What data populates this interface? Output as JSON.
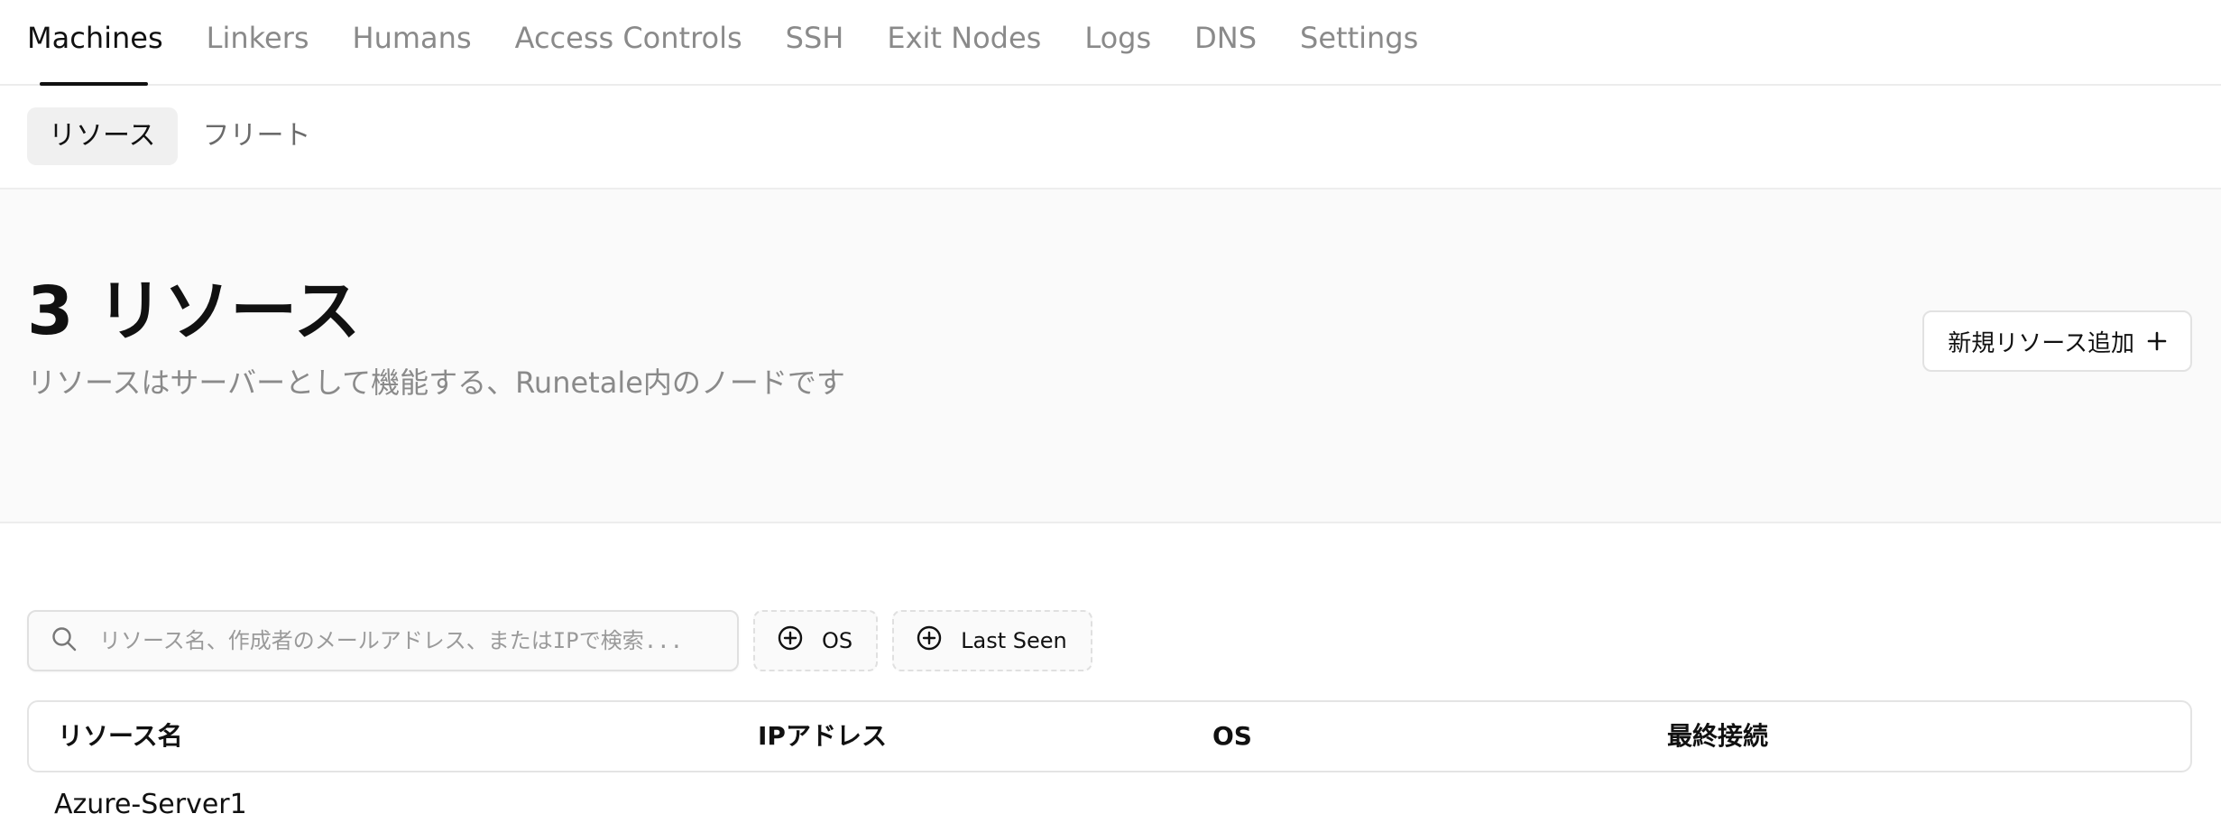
{
  "nav": {
    "tabs": [
      {
        "label": "Machines",
        "active": true
      },
      {
        "label": "Linkers"
      },
      {
        "label": "Humans"
      },
      {
        "label": "Access Controls"
      },
      {
        "label": "SSH"
      },
      {
        "label": "Exit Nodes"
      },
      {
        "label": "Logs"
      },
      {
        "label": "DNS"
      },
      {
        "label": "Settings"
      }
    ]
  },
  "subtabs": [
    {
      "label": "リソース",
      "active": true
    },
    {
      "label": "フリート"
    }
  ],
  "hero": {
    "title": "3 リソース",
    "subtitle": "リソースはサーバーとして機能する、Runetale内のノードです",
    "add_button_label": "新規リソース追加",
    "add_button_icon": "plus-icon"
  },
  "filters": {
    "search_placeholder": "リソース名、作成者のメールアドレス、またはIPで検索...",
    "search_icon": "search-icon",
    "chips": [
      {
        "label": "OS",
        "icon": "plus-circle-icon"
      },
      {
        "label": "Last Seen",
        "icon": "plus-circle-icon"
      }
    ]
  },
  "table": {
    "columns": [
      "リソース名",
      "IPアドレス",
      "OS",
      "最終接続"
    ],
    "rows": [
      {
        "name": "Azure-Server1"
      }
    ]
  },
  "colors": {
    "text_primary": "#111111",
    "text_muted": "#8a8a8a",
    "border": "#e4e4e4",
    "hero_bg": "#fafafa",
    "active_subtab_bg": "#f0f0f0"
  }
}
